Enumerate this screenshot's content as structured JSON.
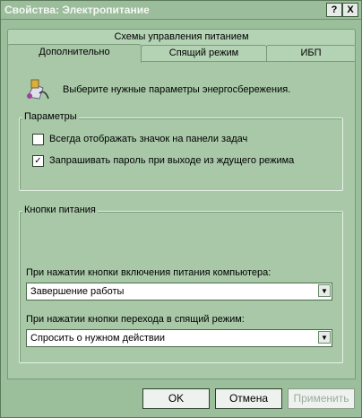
{
  "window": {
    "title": "Свойства: Электропитание",
    "help_label": "?",
    "close_label": "X"
  },
  "tabs": {
    "row1": [
      {
        "label": "Схемы управления питанием"
      }
    ],
    "row2": [
      {
        "label": "Дополнительно",
        "active": true
      },
      {
        "label": "Спящий режим",
        "active": false
      },
      {
        "label": "ИБП",
        "active": false
      }
    ]
  },
  "panel": {
    "intro_text": "Выберите нужные параметры энергосбережения.",
    "params_group": {
      "legend": "Параметры",
      "show_icon": {
        "label": "Всегда отображать значок на панели задач",
        "checked": false
      },
      "ask_password": {
        "label": "Запрашивать пароль при выходе из ждущего режима",
        "checked": true
      }
    },
    "power_buttons_group": {
      "legend": "Кнопки питания",
      "power_button": {
        "label": "При нажатии кнопки включения питания компьютера:",
        "value": "Завершение работы"
      },
      "sleep_button": {
        "label": "При нажатии кнопки перехода в спящий режим:",
        "value": "Спросить о нужном действии"
      }
    }
  },
  "buttons": {
    "ok": "OK",
    "cancel": "Отмена",
    "apply": "Применить"
  },
  "colors": {
    "background": "#9bbf9b",
    "panel": "#a8c8a8",
    "title_text": "#f4f8f4"
  }
}
